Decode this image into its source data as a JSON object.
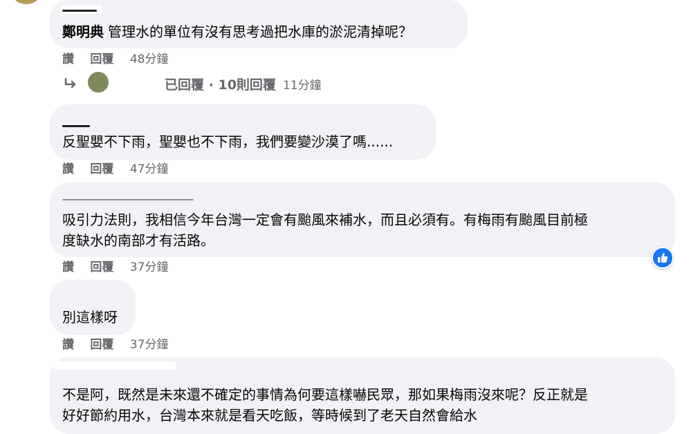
{
  "comments": [
    {
      "author": "鄭明典",
      "text": "管理水的單位有沒有思考過把水庫的淤泥清掉呢？",
      "actions": {
        "like": "讚",
        "reply": "回覆",
        "time": "48分鐘"
      },
      "replies": {
        "prefix": "已回覆",
        "separator": " · ",
        "count": "10則回覆",
        "time": "11分鐘"
      }
    },
    {
      "text": "反聖嬰不下雨，聖嬰也不下雨，我們要變沙漠了嗎......",
      "actions": {
        "like": "讚",
        "reply": "回覆",
        "time": "47分鐘"
      }
    },
    {
      "line1": "吸引力法則，我相信今年台灣一定會有颱風來補水，而且必須有。有梅雨有颱風目前極",
      "line2": "度缺水的南部才有活路。",
      "actions": {
        "like": "讚",
        "reply": "回覆",
        "time": "37分鐘"
      }
    },
    {
      "text": "別這樣呀",
      "actions": {
        "like": "讚",
        "reply": "回覆",
        "time": "37分鐘"
      }
    },
    {
      "line1": "不是阿，既然是未來還不確定的事情為何要這樣嚇民眾，那如果梅雨沒來呢？反正就是",
      "line2": "好好節約用水，台灣本來就是看天吃飯，等時候到了老天自然會給水"
    }
  ],
  "icons": {
    "reply_arrow": "reply-arrow-icon",
    "like_badge": "thumbs-up-icon"
  },
  "colors": {
    "bubble": "#f0f2f5",
    "secondary_text": "#65676b",
    "like_blue": "#1877f2"
  }
}
